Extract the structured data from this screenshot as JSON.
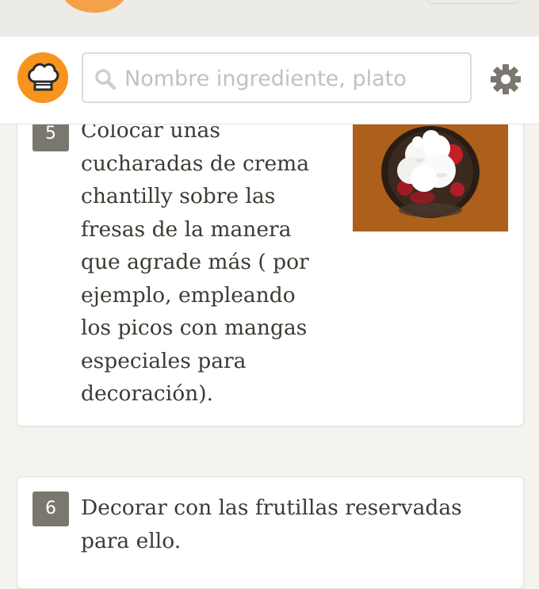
{
  "header": {
    "logo_icon": "chef-hat-icon",
    "search_icon": "search-icon",
    "search_placeholder": "Nombre ingrediente, plato",
    "settings_icon": "gear-icon",
    "brand_color": "#f7941d"
  },
  "steps": [
    {
      "number": "5",
      "text": "Colocar unas cucharadas de crema chantilly sobre las fresas de la manera que agrade más ( por ejemplo, empleando los picos con mangas especiales para decoración).",
      "has_photo": true
    },
    {
      "number": "6",
      "text": "Decorar con las frutillas reservadas para ello.",
      "has_photo": false
    }
  ]
}
